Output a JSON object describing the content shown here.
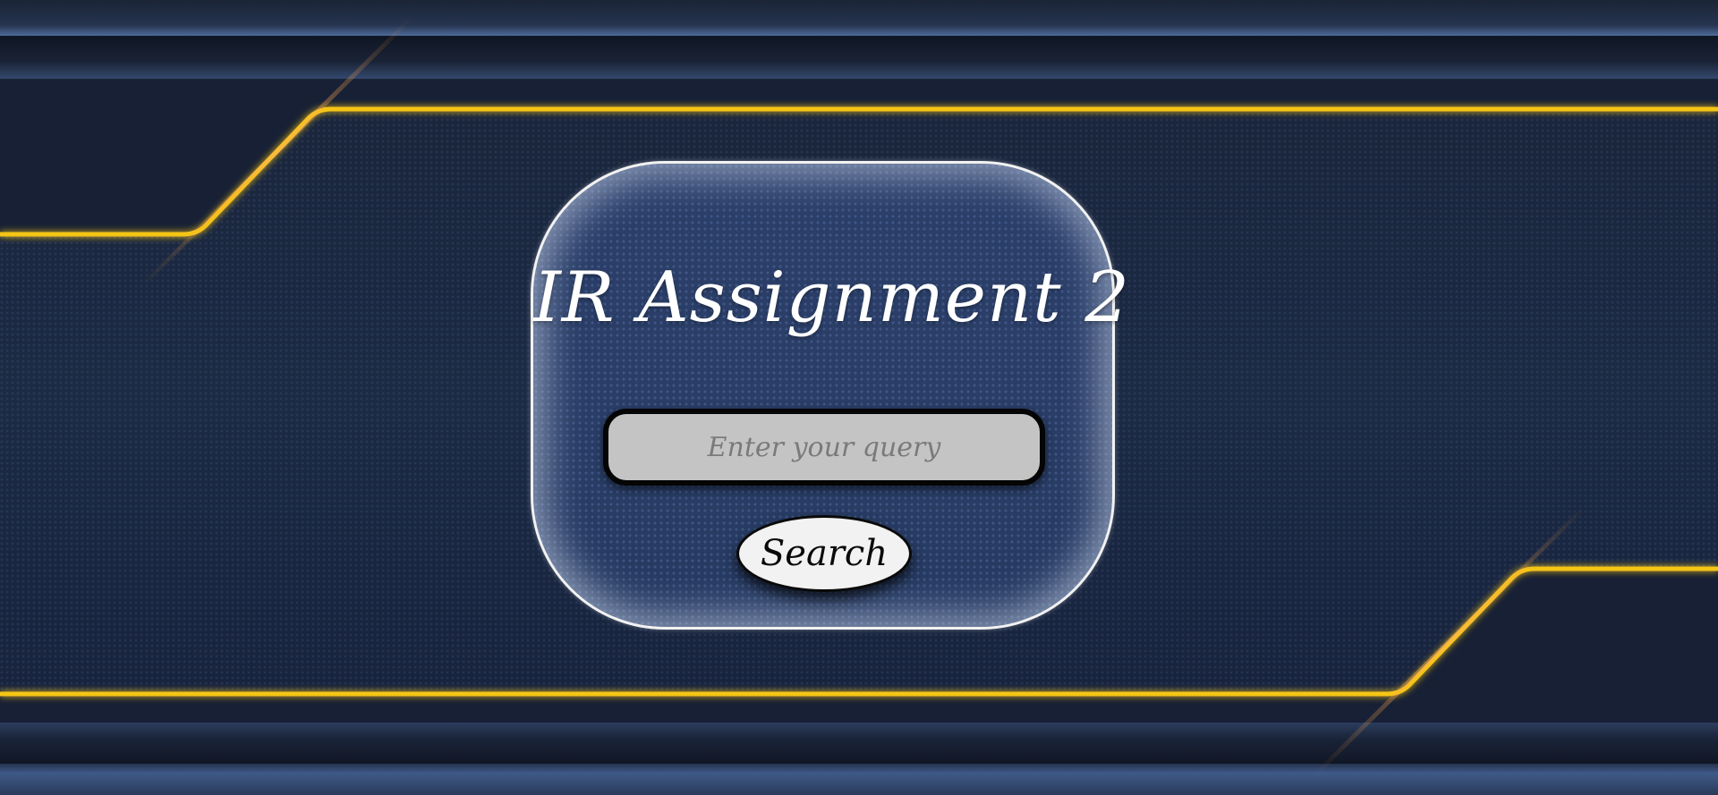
{
  "header": {
    "title": "IR Assignment 2"
  },
  "search": {
    "placeholder": "Enter your query",
    "value": "",
    "button_label": "Search"
  },
  "colors": {
    "gold_accent": "#f5c518",
    "card_border": "#f2f2f2",
    "input_background": "#c4c4c4",
    "button_background": "#f2f2f2"
  }
}
